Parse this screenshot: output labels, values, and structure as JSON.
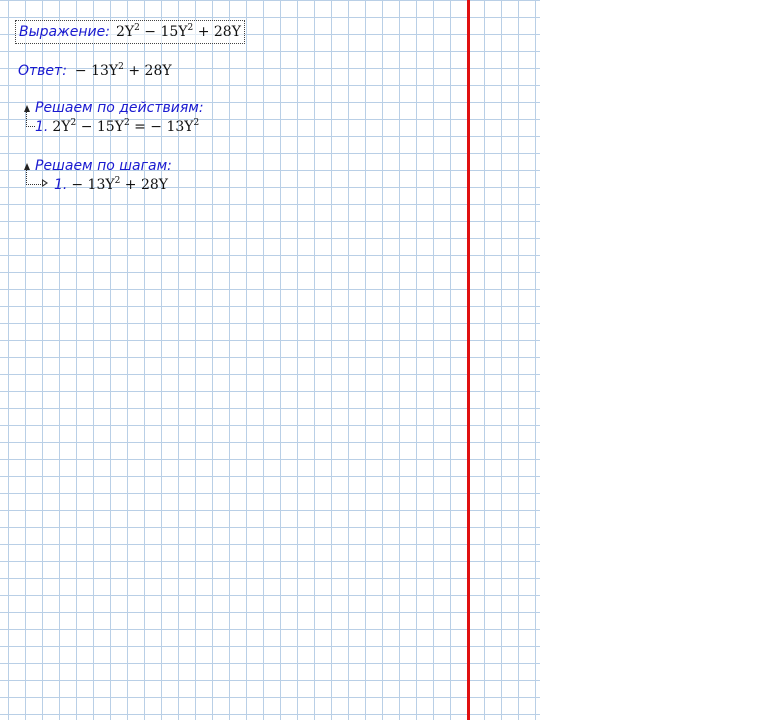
{
  "expression": {
    "label": "Выражение:",
    "parts": [
      "2Y",
      "2",
      " − 15Y",
      "2",
      " + 28Y"
    ]
  },
  "answer": {
    "label": "Ответ:",
    "parts": [
      "− 13Y",
      "2",
      " + 28Y"
    ]
  },
  "by_actions": {
    "title": "Решаем по действиям:",
    "steps": [
      {
        "number": "1.",
        "parts": [
          "2Y",
          "2",
          " − 15Y",
          "2",
          " = − 13Y",
          "2"
        ]
      }
    ]
  },
  "by_steps": {
    "title": "Решаем по шагам:",
    "steps": [
      {
        "number": "1.",
        "parts": [
          "− 13Y",
          "2",
          " + 28Y"
        ]
      }
    ]
  },
  "colors": {
    "grid": "#b9cfe6",
    "margin_line": "#e01010",
    "label_text": "#1a1ad0",
    "math_text": "#111111"
  }
}
